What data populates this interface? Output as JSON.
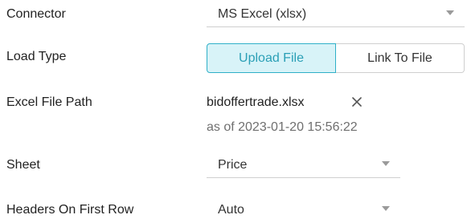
{
  "form": {
    "connector": {
      "label": "Connector",
      "value": "MS Excel (xlsx)",
      "caret_icon": "chevron-down-icon"
    },
    "load_type": {
      "label": "Load Type",
      "options": [
        "Upload File",
        "Link To File"
      ],
      "selected": "Upload File"
    },
    "excel_file_path": {
      "label": "Excel File Path",
      "file_name": "bidoffertrade.xlsx",
      "clear_icon": "close-icon",
      "as_of": "as of 2023-01-20 15:56:22"
    },
    "sheet": {
      "label": "Sheet",
      "value": "Price",
      "caret_icon": "chevron-down-icon"
    },
    "headers_on_first_row": {
      "label": "Headers On First Row",
      "value": "Auto",
      "caret_icon": "chevron-down-icon"
    }
  },
  "colors": {
    "accent": "#2fb0c8",
    "accent_bg": "#d8f3f8",
    "muted_text": "#6f6f6f"
  }
}
